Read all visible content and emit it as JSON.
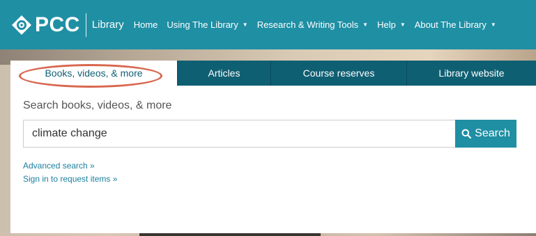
{
  "header": {
    "logo_text": "PCC",
    "logo_sub": "Library",
    "nav": [
      {
        "label": "Home",
        "has_menu": false
      },
      {
        "label": "Using The Library",
        "has_menu": true
      },
      {
        "label": "Research & Writing Tools",
        "has_menu": true
      },
      {
        "label": "Help",
        "has_menu": true
      },
      {
        "label": "About The Library",
        "has_menu": true
      }
    ]
  },
  "tabs": [
    {
      "label": "Books, videos, & more",
      "active": true
    },
    {
      "label": "Articles",
      "active": false
    },
    {
      "label": "Course reserves",
      "active": false
    },
    {
      "label": "Library website",
      "active": false
    }
  ],
  "search": {
    "label": "Search books, videos, & more",
    "value": "climate change",
    "button_label": "Search"
  },
  "links": {
    "advanced": "Advanced search »",
    "sign_in": "Sign in to request items »"
  },
  "colors": {
    "brand": "#1f8fa4",
    "tab_dark": "#0f5f73",
    "highlight": "#d9674f",
    "link": "#1a7fa0"
  }
}
